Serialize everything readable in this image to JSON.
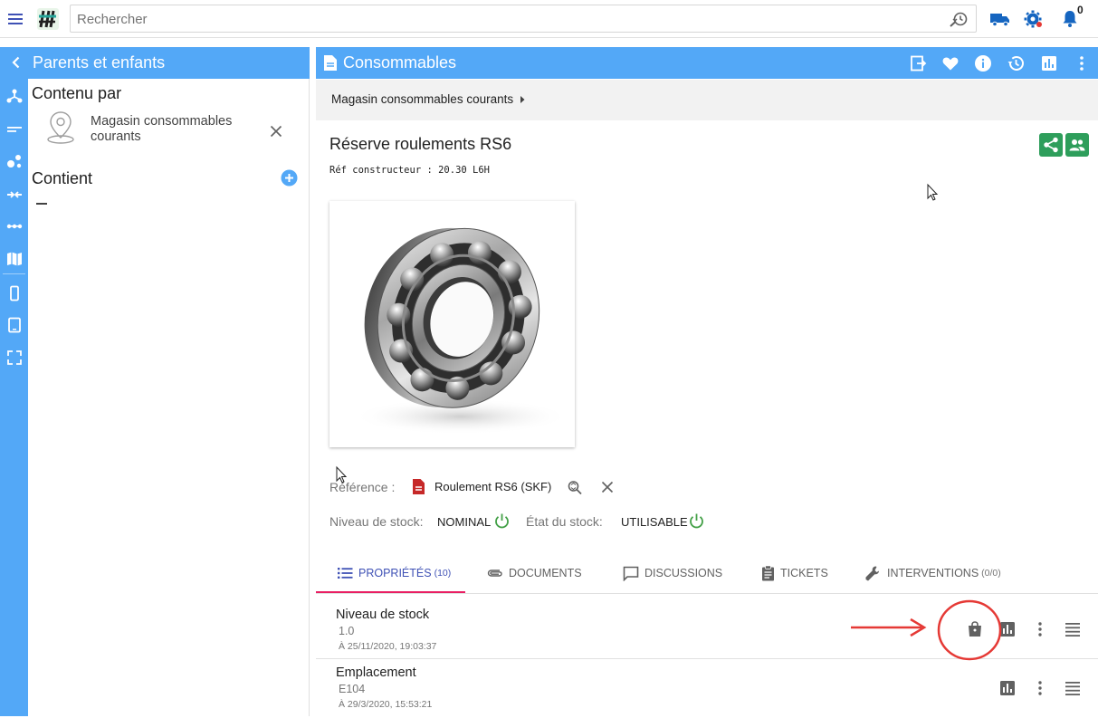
{
  "topbar": {
    "search_placeholder": "Rechercher",
    "notification_count": "0",
    "icons": [
      "menu-icon",
      "app-logo",
      "history-search-icon",
      "truck-icon",
      "settings-gear-icon",
      "bell-icon"
    ]
  },
  "nav_rail": {
    "icons": [
      "hierarchy-icon",
      "lines-icon",
      "molecule-icon",
      "merge-arrows-icon",
      "dots-line-icon",
      "map-icon",
      "phone-icon",
      "tablet-icon",
      "fullscreen-icon"
    ]
  },
  "left_panel": {
    "title": "Parents et enfants",
    "contained_by_label": "Contenu par",
    "parent_name": "Magasin consommables courants",
    "contains_label": "Contient",
    "contains_empty": "—"
  },
  "right_panel": {
    "title": "Consommables",
    "breadcrumb": "Magasin consommables courants",
    "item_title": "Réserve roulements RS6",
    "manufacturer_ref": "Réf constructeur : 20.30 L6H",
    "reference": {
      "label": "Référence :",
      "value": "Roulement RS6 (SKF)"
    },
    "stock_level": {
      "label": "Niveau de stock:",
      "value": "NOMINAL"
    },
    "stock_state": {
      "label": "État du stock:",
      "value": "UTILISABLE"
    },
    "tabs": [
      {
        "label": "PROPRIÉTÉS",
        "count": "(10)",
        "icon": "list-icon",
        "active": true
      },
      {
        "label": "DOCUMENTS",
        "count": "",
        "icon": "paperclip-icon",
        "active": false
      },
      {
        "label": "DISCUSSIONS",
        "count": "",
        "icon": "chat-icon",
        "active": false
      },
      {
        "label": "TICKETS",
        "count": "",
        "icon": "clipboard-icon",
        "active": false
      },
      {
        "label": "INTERVENTIONS",
        "count": "(0/0)",
        "icon": "wrench-icon",
        "active": false
      }
    ],
    "properties": [
      {
        "name": "Niveau de stock",
        "value": "1.0",
        "date": "À 25/11/2020, 19:03:37"
      },
      {
        "name": "Emplacement",
        "value": "E104",
        "date": "À 29/3/2020, 15:53:21"
      }
    ]
  },
  "colors": {
    "primary_blue": "#53a8f7",
    "share_green": "#2e9e5b",
    "active_tab": "#3f51b5",
    "tab_underline": "#e91e63",
    "status_green": "#43a047",
    "annotation_red": "#e53935",
    "doc_red": "#c62828"
  }
}
